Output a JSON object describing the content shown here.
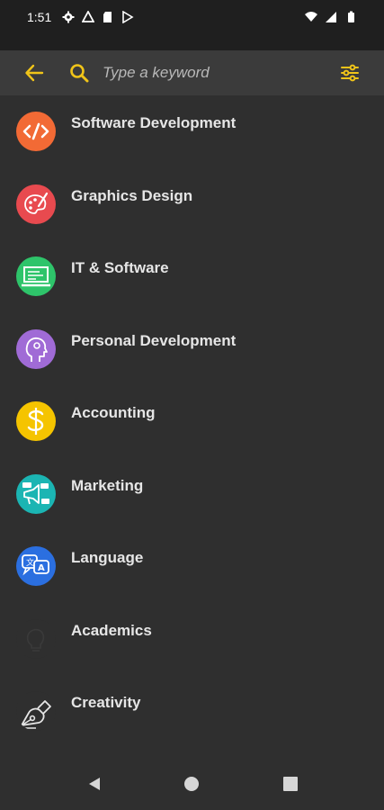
{
  "status_bar": {
    "time": "1:51"
  },
  "search": {
    "placeholder": "Type a keyword"
  },
  "colors": {
    "accent": "#f0c419",
    "background": "#2f2f2f",
    "toolbar": "#3b3b3b"
  },
  "categories": [
    {
      "label": "Software Development",
      "icon": "code-icon",
      "color": "#f26a35"
    },
    {
      "label": "Graphics Design",
      "icon": "palette-icon",
      "color": "#e84a4f"
    },
    {
      "label": "IT & Software",
      "icon": "monitor-icon",
      "color": "#2ec46a"
    },
    {
      "label": "Personal Development",
      "icon": "head-icon",
      "color": "#a06bd6"
    },
    {
      "label": "Accounting",
      "icon": "dollar-icon",
      "color": "#f5c400"
    },
    {
      "label": "Marketing",
      "icon": "megaphone-icon",
      "color": "#1bb5b3"
    },
    {
      "label": "Language",
      "icon": "translate-icon",
      "color": "#2b6fe0"
    },
    {
      "label": "Academics",
      "icon": "bulb-icon",
      "color": "#2f2f2f"
    },
    {
      "label": "Creativity",
      "icon": "pen-nib-icon",
      "color": "#2f2f2f"
    }
  ]
}
